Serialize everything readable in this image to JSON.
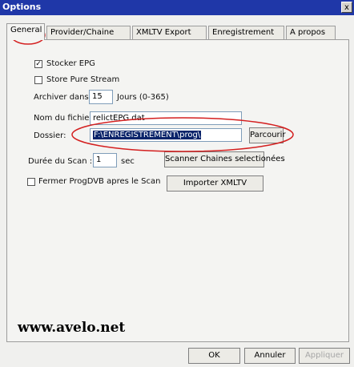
{
  "window": {
    "title": "Options",
    "close_glyph": "x"
  },
  "tabs": [
    "General",
    "Provider/Chaine",
    "XMLTV Export",
    "Enregistrement",
    "A propos"
  ],
  "general": {
    "stocker_epg": {
      "label": "Stocker EPG",
      "checked": true,
      "mark": "✓"
    },
    "store_pure_stream": {
      "label": "Store Pure Stream",
      "checked": false
    },
    "archiver": {
      "label": "Archiver dans:",
      "value": "15",
      "unit": "Jours (0-365)"
    },
    "nom_fichier": {
      "label": "Nom du fichier:",
      "value": "relictEPG.dat"
    },
    "dossier": {
      "label": "Dossier:",
      "value": "F:\\ENREGISTREMENT\\prog\\",
      "button": "Parcourir"
    },
    "duree_scan": {
      "label": "Durée du Scan :",
      "value": "1",
      "unit": "sec"
    },
    "scanner_button": "Scanner Chaines selectionées",
    "fermer": {
      "label": "Fermer ProgDVB apres le Scan",
      "checked": false
    },
    "importer_button": "Importer  XMLTV"
  },
  "watermark": "www.avelo.net",
  "footer": {
    "ok": "OK",
    "annuler": "Annuler",
    "appliquer": "Appliquer"
  },
  "colors": {
    "titlebar": "#1f37a8",
    "annotation": "#d42020",
    "selection": "#0a246a"
  }
}
